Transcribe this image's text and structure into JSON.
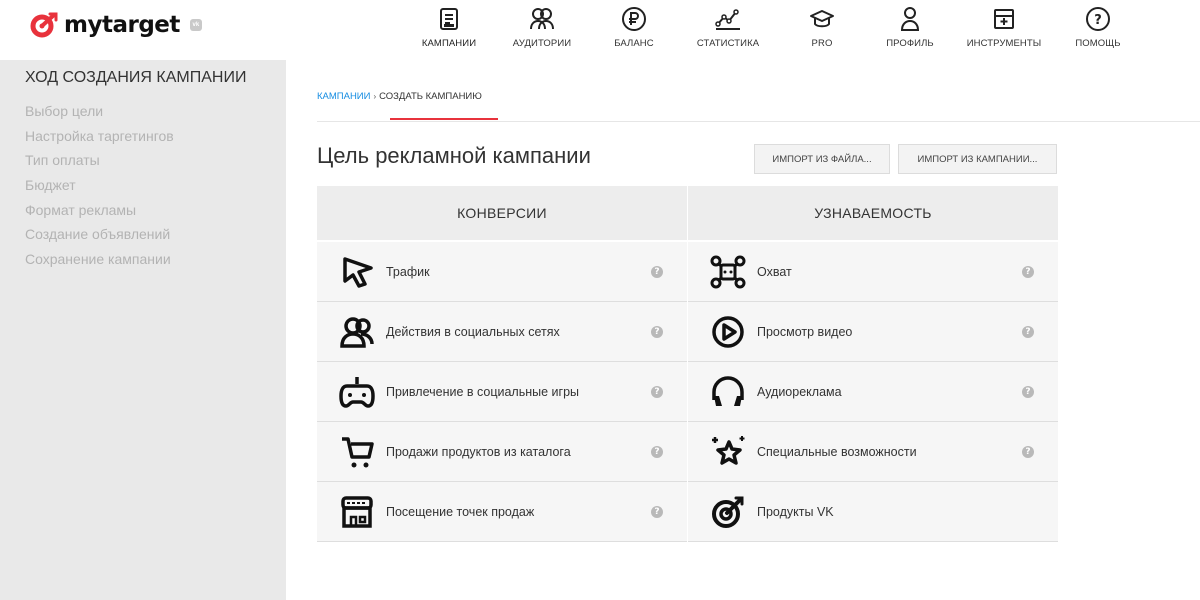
{
  "brand": {
    "name": "mytarget",
    "badge": "vk",
    "accent": "#e8323c",
    "link": "#168de2"
  },
  "nav": [
    {
      "label": "КАМПАНИИ",
      "icon": "document-icon",
      "active": true
    },
    {
      "label": "АУДИТОРИИ",
      "icon": "audience-icon"
    },
    {
      "label": "БАЛАНС",
      "icon": "ruble-icon"
    },
    {
      "label": "СТАТИСТИКА",
      "icon": "stats-icon"
    },
    {
      "label": "PRO",
      "icon": "graduation-cap-icon"
    },
    {
      "label": "ПРОФИЛЬ",
      "icon": "profile-icon"
    },
    {
      "label": "ИНСТРУМЕНТЫ",
      "icon": "tools-icon"
    },
    {
      "label": "ПОМОЩЬ",
      "icon": "help-circle-icon"
    }
  ],
  "sidebar": {
    "title": "ХОД СОЗДАНИЯ КАМПАНИИ",
    "steps": [
      "Выбор цели",
      "Настройка таргетингов",
      "Тип оплаты",
      "Бюджет",
      "Формат рекламы",
      "Создание объявлений",
      "Сохранение кампании"
    ]
  },
  "breadcrumb": {
    "link": "КАМПАНИИ",
    "separator": "›",
    "current": "СОЗДАТЬ КАМПАНИЮ"
  },
  "page_title": "Цель рекламной кампании",
  "buttons": {
    "import_file": "ИМПОРТ ИЗ ФАЙЛА...",
    "import_campaign": "ИМПОРТ ИЗ КАМПАНИИ..."
  },
  "columns": [
    {
      "header": "КОНВЕРСИИ",
      "items": [
        {
          "label": "Трафик",
          "icon": "cursor-icon",
          "help": "?"
        },
        {
          "label": "Действия в социальных сетях",
          "icon": "social-people-icon",
          "help": "?"
        },
        {
          "label": "Привлечение в социальные игры",
          "icon": "gamepad-icon",
          "help": "?"
        },
        {
          "label": "Продажи продуктов из каталога",
          "icon": "cart-icon",
          "help": "?"
        },
        {
          "label": "Посещение точек продаж",
          "icon": "store-icon",
          "help": "?"
        }
      ]
    },
    {
      "header": "УЗНАВАЕМОСТЬ",
      "items": [
        {
          "label": "Охват",
          "icon": "reach-nodes-icon",
          "help": "?"
        },
        {
          "label": "Просмотр видео",
          "icon": "play-icon",
          "help": "?"
        },
        {
          "label": "Аудиореклама",
          "icon": "headphones-icon",
          "help": "?"
        },
        {
          "label": "Специальные возможности",
          "icon": "stars-icon",
          "help": "?"
        },
        {
          "label": "Продукты VK",
          "icon": "target-icon"
        }
      ]
    }
  ]
}
